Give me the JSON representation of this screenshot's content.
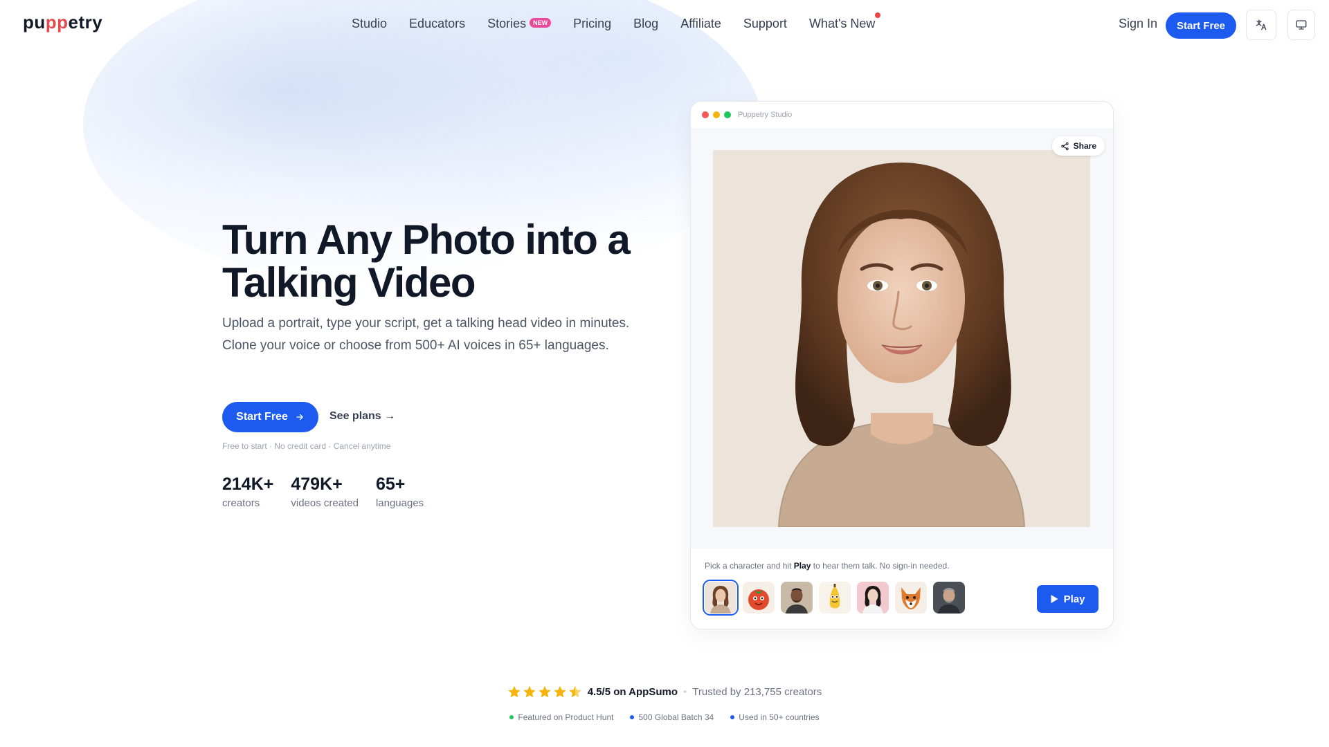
{
  "nav": {
    "logo": {
      "pre": "pu",
      "accent": "pp",
      "post": "etry"
    },
    "links": [
      "Studio",
      "Educators",
      "Stories",
      "Pricing",
      "Blog",
      "Affiliate",
      "Support",
      "What's New"
    ],
    "stories_badge": "NEW",
    "sign_in": "Sign In",
    "cta": "Start Free",
    "icons": [
      "translate-icon",
      "monitor-icon"
    ]
  },
  "hero": {
    "title_line1": "Turn Any Photo into a",
    "title_line2": "Talking Video",
    "subtitle": "Upload a portrait, type your script, get a talking head video in minutes. Clone your voice or choose from 500+ AI voices in 65+ languages.",
    "primary_cta": "Start Free",
    "secondary_cta": "See plans →",
    "fine_print": "Free to start · No credit card · Cancel anytime",
    "stats": [
      {
        "value": "214K+",
        "label": "creators"
      },
      {
        "value": "479K+",
        "label": "videos created"
      },
      {
        "value": "65+",
        "label": "languages"
      }
    ]
  },
  "studio": {
    "window_title": "Puppetry Studio",
    "share_label": "Share",
    "pick_prefix": "Pick a character and hit ",
    "pick_bold": "Play",
    "pick_suffix": " to hear them talk. No sign-in needed.",
    "play_label": "Play",
    "characters": [
      "woman-portrait",
      "tomato-character",
      "man-portrait",
      "banana-character",
      "asian-woman-portrait",
      "fox-character",
      "older-man-portrait"
    ]
  },
  "trust": {
    "rating": "4.5/5 on AppSumo",
    "trusted": "Trusted by 213,755 creators",
    "features": [
      "Featured on Product Hunt",
      "500 Global Batch 34",
      "Used in 50+ countries"
    ]
  },
  "colors": {
    "accent": "#1d5bf0",
    "brand_red": "#e5484d",
    "star": "#f5b50a",
    "badge": "#ec4899"
  }
}
